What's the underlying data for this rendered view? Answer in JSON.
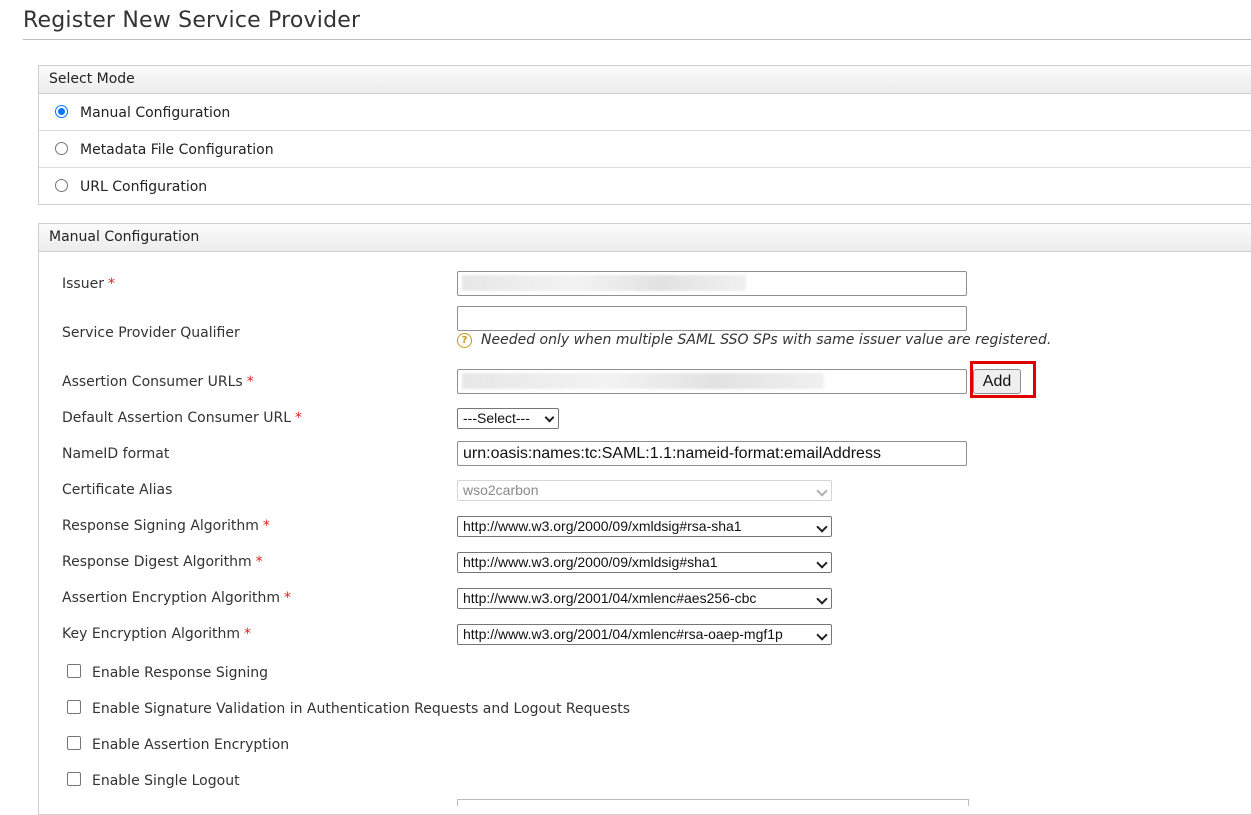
{
  "page": {
    "title": "Register New Service Provider"
  },
  "select_mode": {
    "header": "Select Mode",
    "options": [
      {
        "label": "Manual Configuration",
        "checked": true
      },
      {
        "label": "Metadata File Configuration",
        "checked": false
      },
      {
        "label": "URL Configuration",
        "checked": false
      }
    ]
  },
  "manual_config": {
    "header": "Manual Configuration",
    "required_marker": "*",
    "issuer": {
      "label": "Issuer",
      "value": ""
    },
    "sp_qualifier": {
      "label": "Service Provider Qualifier",
      "value": "",
      "hint": "Needed only when multiple SAML SSO SPs with same issuer value are registered.",
      "hint_icon": "?"
    },
    "acs_urls": {
      "label": "Assertion Consumer URLs",
      "value": "",
      "add_label": "Add"
    },
    "default_acs": {
      "label": "Default Assertion Consumer URL",
      "selected": "---Select---"
    },
    "nameid_format": {
      "label": "NameID format",
      "value": "urn:oasis:names:tc:SAML:1.1:nameid-format:emailAddress"
    },
    "cert_alias": {
      "label": "Certificate Alias",
      "selected": "wso2carbon"
    },
    "response_signing": {
      "label": "Response Signing Algorithm",
      "selected": "http://www.w3.org/2000/09/xmldsig#rsa-sha1"
    },
    "response_digest": {
      "label": "Response Digest Algorithm",
      "selected": "http://www.w3.org/2000/09/xmldsig#sha1"
    },
    "assertion_encryption": {
      "label": "Assertion Encryption Algorithm",
      "selected": "http://www.w3.org/2001/04/xmlenc#aes256-cbc"
    },
    "key_encryption": {
      "label": "Key Encryption Algorithm",
      "selected": "http://www.w3.org/2001/04/xmlenc#rsa-oaep-mgf1p"
    },
    "checkboxes": [
      {
        "label": "Enable Response Signing",
        "checked": false
      },
      {
        "label": "Enable Signature Validation in Authentication Requests and Logout Requests",
        "checked": false
      },
      {
        "label": "Enable Assertion Encryption",
        "checked": false
      },
      {
        "label": "Enable Single Logout",
        "checked": false
      }
    ]
  },
  "colors": {
    "accent": "#0075ff",
    "required": "#e02020",
    "highlight": "#e00000"
  }
}
